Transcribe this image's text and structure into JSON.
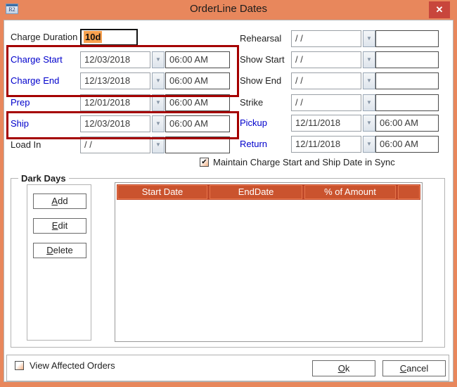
{
  "window": {
    "title": "OrderLine Dates",
    "icon_text": "R2"
  },
  "icons": {
    "close": "✕",
    "dropdown": "▼",
    "check": "✔"
  },
  "colors": {
    "titlebar": "#E8875C",
    "close_button": "#C8463C",
    "highlight_box": "#A50000",
    "grid_header": "#CA532E",
    "text_selection": "#F7A04E",
    "linked_label": "#0000CC"
  },
  "fields": {
    "left": [
      {
        "label": "Charge Duration",
        "value": "10d"
      },
      {
        "label": "Charge Start",
        "date": "12/03/2018",
        "time": "06:00 AM"
      },
      {
        "label": "Charge End",
        "date": "12/13/2018",
        "time": "06:00 AM"
      },
      {
        "label": "Prep",
        "date": "12/01/2018",
        "time": "06:00 AM"
      },
      {
        "label": "Ship",
        "date": "12/03/2018",
        "time": "06:00 AM"
      },
      {
        "label": "Load In",
        "date": "/  /",
        "time": ""
      }
    ],
    "right": [
      {
        "label": "Rehearsal",
        "date": "/  /",
        "time": ""
      },
      {
        "label": "Show Start",
        "date": "/  /",
        "time": ""
      },
      {
        "label": "Show End",
        "date": "/  /",
        "time": ""
      },
      {
        "label": "Strike",
        "date": "/  /",
        "time": ""
      },
      {
        "label": "Pickup",
        "date": "12/11/2018",
        "time": "06:00 AM"
      },
      {
        "label": "Return",
        "date": "12/11/2018",
        "time": "06:00 AM"
      }
    ]
  },
  "sync": {
    "label": "Maintain Charge Start and Ship Date in Sync",
    "checked": true
  },
  "dark_days": {
    "legend": "Dark Days",
    "buttons": [
      {
        "accel": "A",
        "rest": "dd"
      },
      {
        "accel": "E",
        "rest": "dit"
      },
      {
        "accel": "D",
        "rest": "elete"
      }
    ],
    "columns": [
      "Start Date",
      "EndDate",
      "% of Amount"
    ],
    "rows": []
  },
  "footer": {
    "view_orders_label": "View Affected Orders",
    "view_orders_checked": false,
    "ok": {
      "accel": "O",
      "rest": "k"
    },
    "cancel": {
      "accel": "C",
      "rest": "ancel"
    }
  }
}
